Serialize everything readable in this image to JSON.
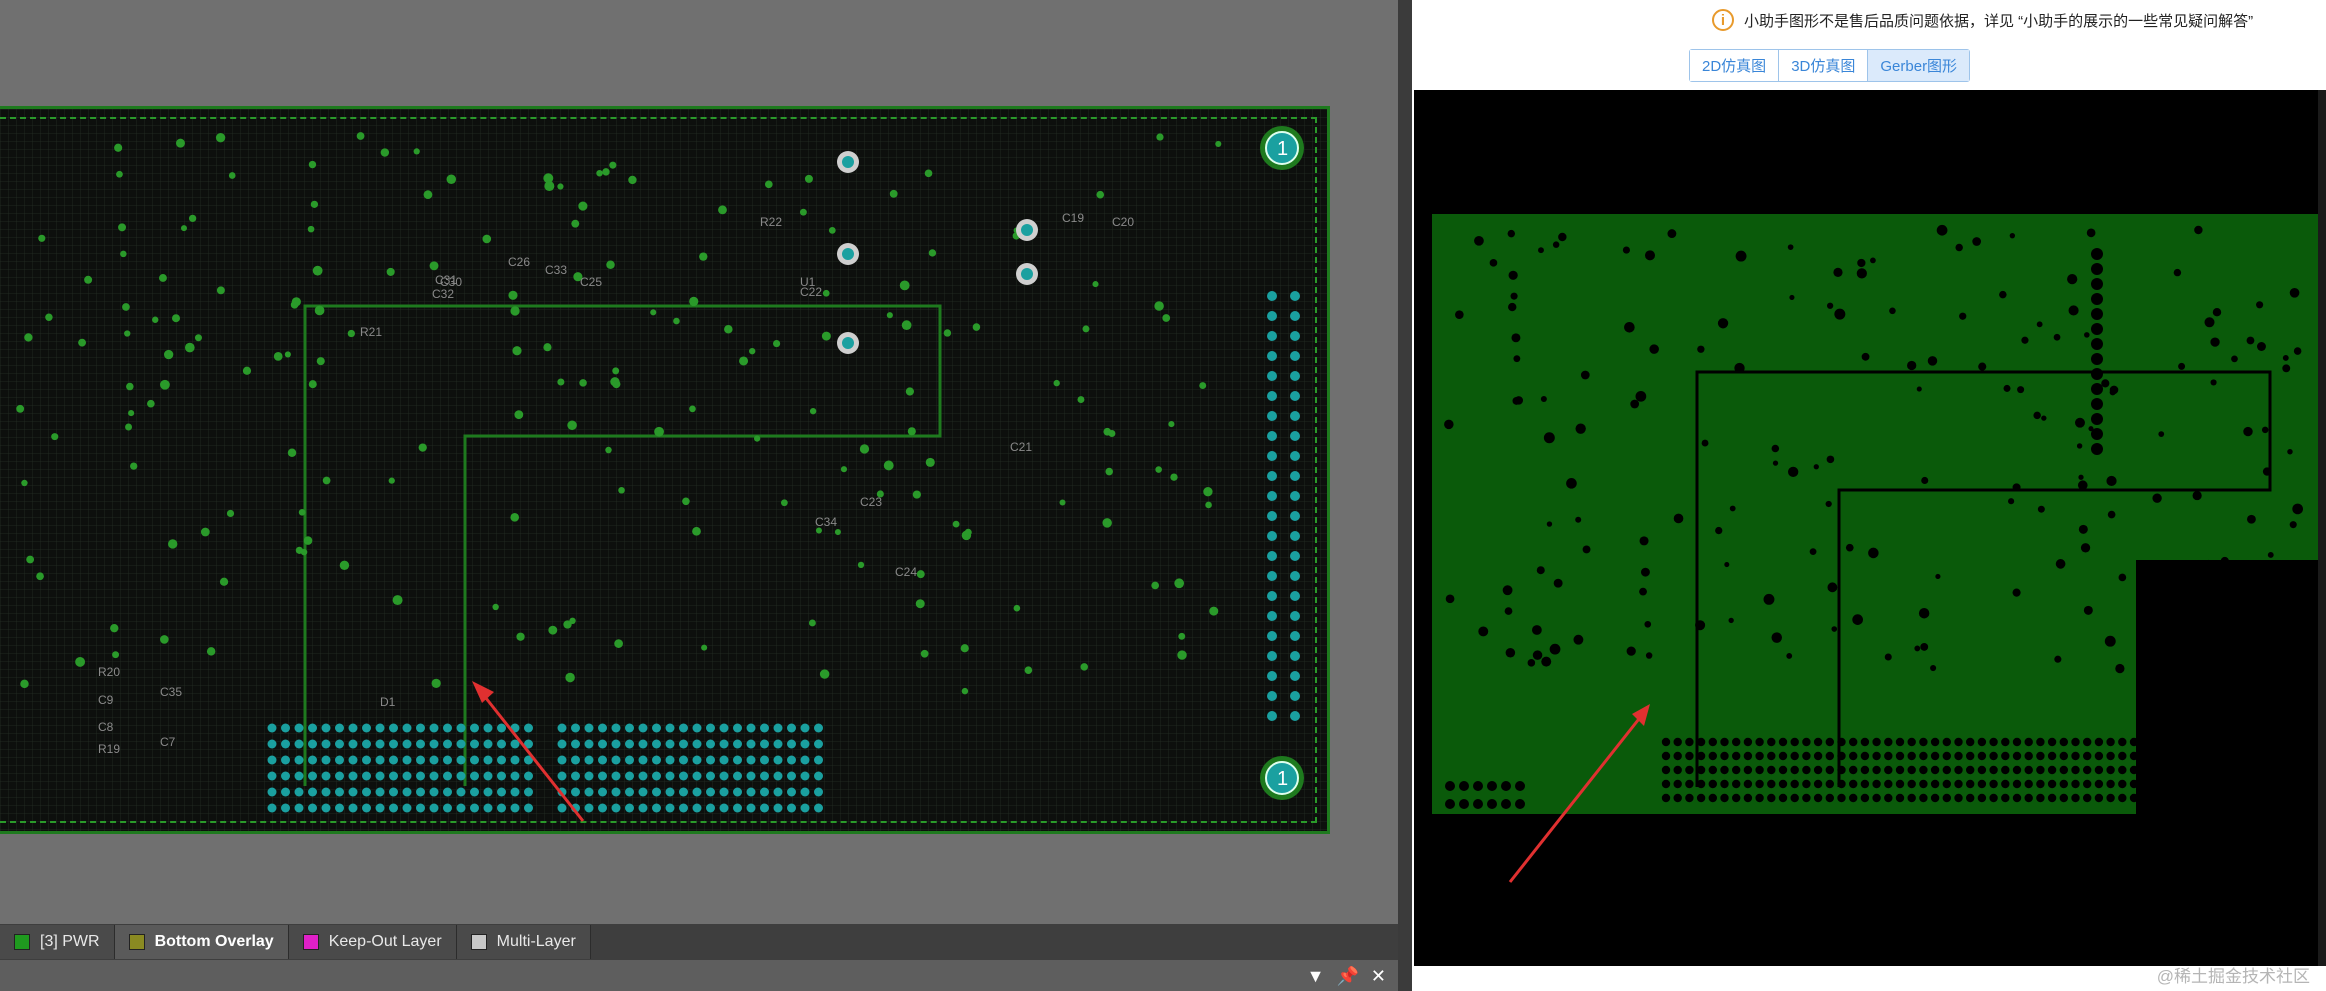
{
  "pcb_editor": {
    "silkscreen_labels": [
      "C19",
      "C20",
      "C21",
      "C22",
      "C23",
      "C24",
      "C25",
      "C26",
      "C30",
      "C31",
      "C32",
      "C33",
      "C34",
      "C35",
      "C7",
      "C8",
      "C9",
      "R19",
      "R20",
      "R21",
      "R22",
      "D1",
      "U1"
    ],
    "pin_one_marker": "1",
    "layer_tabs": [
      {
        "label": "[3] PWR",
        "color": "#1f9a1f",
        "active": false
      },
      {
        "label": "Bottom Overlay",
        "color": "#8a8a22",
        "active": true
      },
      {
        "label": "Keep-Out Layer",
        "color": "#e020c8",
        "active": false
      },
      {
        "label": "Multi-Layer",
        "color": "#c8c8c8",
        "active": false
      }
    ],
    "colors": {
      "board_fill": "#0d0f0d",
      "copper": "#1e7a1e",
      "via": "#1aa0a0",
      "annotation_arrow": "#e03030"
    }
  },
  "gerber_panel": {
    "notice_icon": "info-icon",
    "notice_text": "小助手图形不是售后品质问题依据，详见 “小助手的展示的一些常见疑问解答”",
    "view_tabs": [
      {
        "label": "2D仿真图",
        "active": false
      },
      {
        "label": "3D仿真图",
        "active": false
      },
      {
        "label": "Gerber图形",
        "active": true
      }
    ],
    "colors": {
      "background": "#000000",
      "copper": "#0a5a0a",
      "accent": "#3a86d8"
    },
    "watermark": "@稀土掘金技术社区"
  }
}
